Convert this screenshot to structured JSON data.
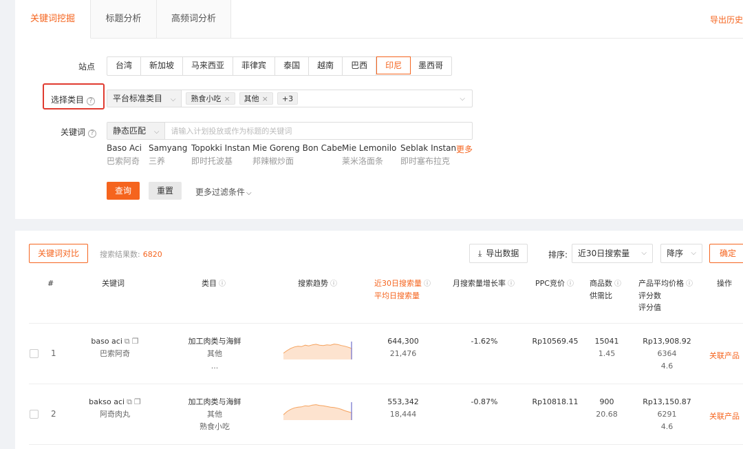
{
  "tabs": [
    "关键词挖掘",
    "标题分析",
    "高频词分析"
  ],
  "export_history": "导出历史",
  "site_label": "站点",
  "sites": [
    "台湾",
    "新加坡",
    "马来西亚",
    "菲律宾",
    "泰国",
    "越南",
    "巴西",
    "印尼",
    "墨西哥"
  ],
  "selected_site": "印尼",
  "category": {
    "label": "选择类目",
    "type": "平台标准类目",
    "chips": [
      "熟食小吃",
      "其他",
      "+3"
    ]
  },
  "keyword": {
    "label": "关键词",
    "match_type": "静态匹配",
    "placeholder": "请输入计划投放或作为标题的关键词",
    "suggestions": [
      {
        "en": "Baso Aci",
        "zh": "巴索阿奇"
      },
      {
        "en": "Samyang",
        "zh": "三养"
      },
      {
        "en": "Topokki Instan",
        "zh": "即时托波基"
      },
      {
        "en": "Mie Goreng Bon Cabe",
        "zh": "邦辣椒炒面"
      },
      {
        "en": "Mie Lemonilo",
        "zh": "莱米洛面条"
      },
      {
        "en": "Seblak Instan",
        "zh": "即时塞布拉克"
      }
    ],
    "more": "更多"
  },
  "actions": {
    "query": "查询",
    "reset": "重置",
    "more_filters": "更多过滤条件"
  },
  "results": {
    "compare_button": "关键词对比",
    "count_label": "搜索结果数:",
    "count": "6820",
    "export_button": "导出数据",
    "sort_label": "排序:",
    "sort_field": "近30日搜索量",
    "sort_order": "降序",
    "confirm": "确定"
  },
  "table": {
    "headers": {
      "index": "#",
      "keyword": "关键词",
      "category": "类目",
      "trend": "搜索趋势",
      "search_30d": "近30日搜索量",
      "search_daily": "平均日搜索量",
      "growth": "月搜索量增长率",
      "ppc": "PPC竞价",
      "products": "商品数",
      "supply_ratio": "供需比",
      "avg_price": "产品平均价格",
      "rating_count": "评分数",
      "rating": "评分值",
      "action": "操作"
    },
    "rows": [
      {
        "num": "1",
        "keyword": "baso aci",
        "keyword_zh": "巴索阿奇",
        "cat1": "加工肉类与海鲜",
        "cat2": "其他",
        "cat3": "...",
        "search_30d": "644,300",
        "search_daily": "21,476",
        "growth": "-1.62%",
        "ppc": "Rp10569.45",
        "products": "15041",
        "supply_ratio": "1.45",
        "avg_price": "Rp13,908.92",
        "rating_count": "6364",
        "rating": "4.6",
        "action": "关联产品",
        "trend": [
          0.35,
          0.5,
          0.62,
          0.7,
          0.74,
          0.72,
          0.8,
          0.76,
          0.82,
          0.85,
          0.8,
          0.78,
          0.82,
          0.8,
          0.86,
          0.84,
          0.78,
          0.74,
          0.68,
          0.6
        ]
      },
      {
        "num": "2",
        "keyword": "bakso aci",
        "keyword_zh": "阿奇肉丸",
        "cat1": "加工肉类与海鲜",
        "cat2": "其他",
        "cat3": "熟食小吃",
        "search_30d": "553,342",
        "search_daily": "18,444",
        "growth": "-0.87%",
        "ppc": "Rp10818.11",
        "products": "900",
        "supply_ratio": "20.68",
        "avg_price": "Rp13,150.87",
        "rating_count": "6291",
        "rating": "4.6",
        "action": "关联产品",
        "trend": [
          0.3,
          0.48,
          0.6,
          0.68,
          0.72,
          0.74,
          0.8,
          0.78,
          0.84,
          0.86,
          0.82,
          0.8,
          0.76,
          0.72,
          0.7,
          0.66,
          0.6,
          0.52,
          0.46,
          0.4
        ]
      }
    ]
  }
}
